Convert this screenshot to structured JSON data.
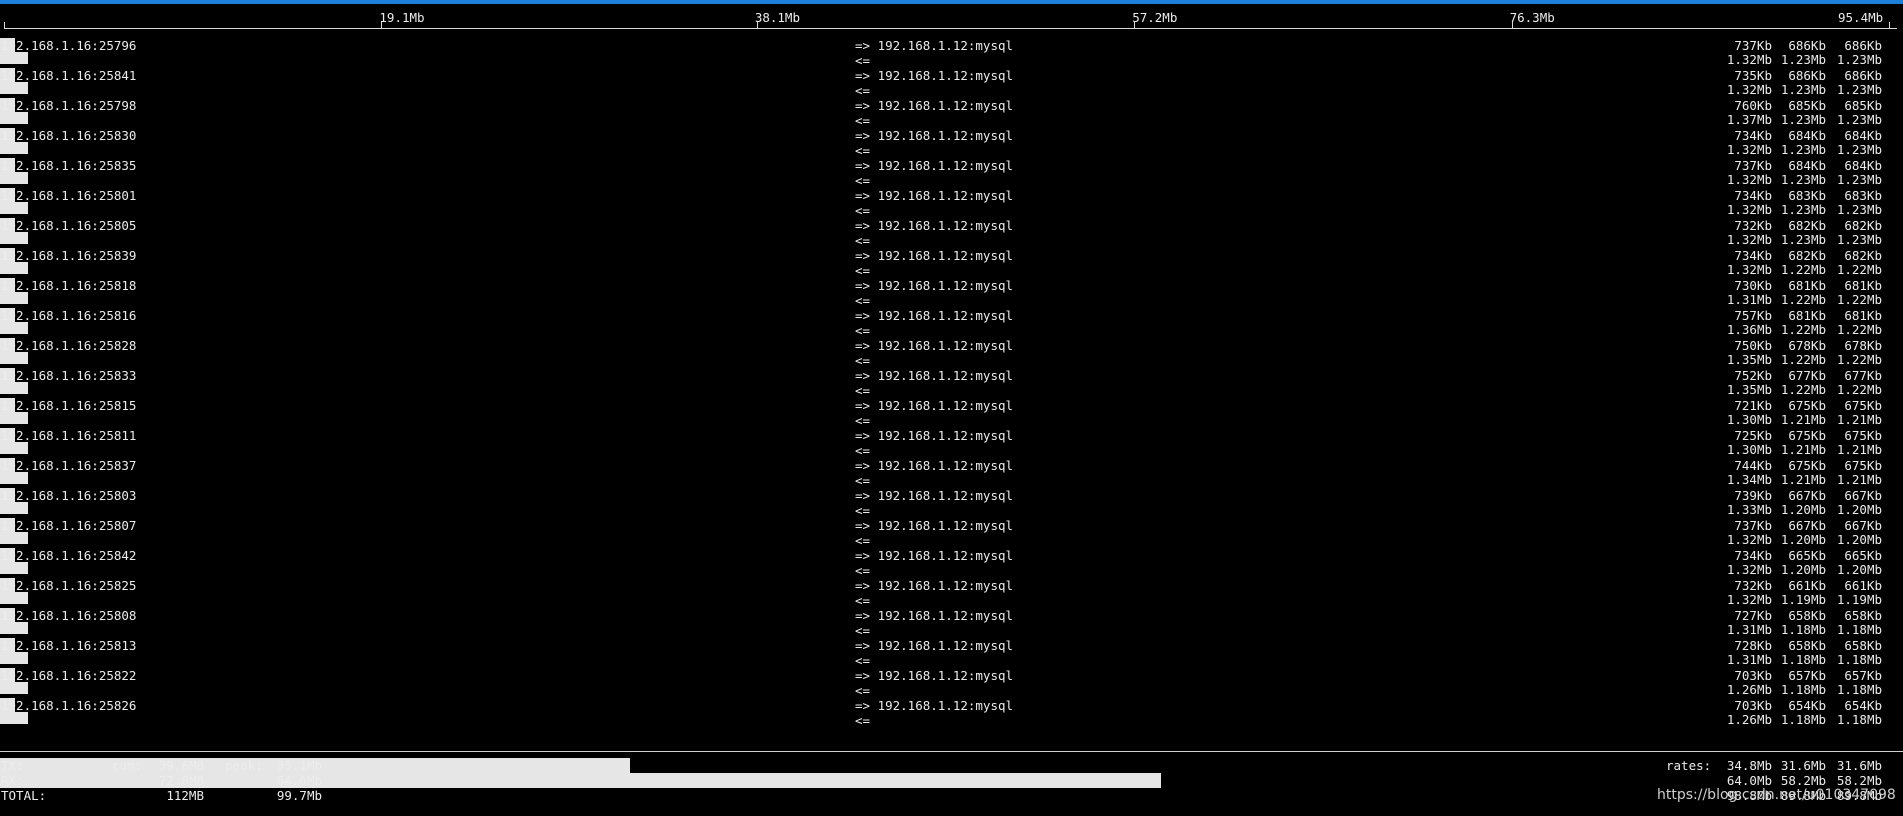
{
  "scale": {
    "labels": [
      "19.1Mb",
      "38.1Mb",
      "57.2Mb",
      "76.3Mb",
      "95.4Mb"
    ],
    "tick_values_mb": [
      19.1,
      38.1,
      57.2,
      76.3,
      95.4
    ],
    "max_mb": 95.4
  },
  "connections": [
    {
      "src": "192.168.1.16:25796",
      "out": "=> 192.168.1.12:mysql",
      "in": "<=",
      "tx": [
        "737Kb",
        "686Kb",
        "686Kb"
      ],
      "rx": [
        "1.32Mb",
        "1.23Mb",
        "1.23Mb"
      ]
    },
    {
      "src": "192.168.1.16:25841",
      "out": "=> 192.168.1.12:mysql",
      "in": "<=",
      "tx": [
        "735Kb",
        "686Kb",
        "686Kb"
      ],
      "rx": [
        "1.32Mb",
        "1.23Mb",
        "1.23Mb"
      ]
    },
    {
      "src": "192.168.1.16:25798",
      "out": "=> 192.168.1.12:mysql",
      "in": "<=",
      "tx": [
        "760Kb",
        "685Kb",
        "685Kb"
      ],
      "rx": [
        "1.37Mb",
        "1.23Mb",
        "1.23Mb"
      ]
    },
    {
      "src": "192.168.1.16:25830",
      "out": "=> 192.168.1.12:mysql",
      "in": "<=",
      "tx": [
        "734Kb",
        "684Kb",
        "684Kb"
      ],
      "rx": [
        "1.32Mb",
        "1.23Mb",
        "1.23Mb"
      ]
    },
    {
      "src": "192.168.1.16:25835",
      "out": "=> 192.168.1.12:mysql",
      "in": "<=",
      "tx": [
        "737Kb",
        "684Kb",
        "684Kb"
      ],
      "rx": [
        "1.32Mb",
        "1.23Mb",
        "1.23Mb"
      ]
    },
    {
      "src": "192.168.1.16:25801",
      "out": "=> 192.168.1.12:mysql",
      "in": "<=",
      "tx": [
        "734Kb",
        "683Kb",
        "683Kb"
      ],
      "rx": [
        "1.32Mb",
        "1.23Mb",
        "1.23Mb"
      ]
    },
    {
      "src": "192.168.1.16:25805",
      "out": "=> 192.168.1.12:mysql",
      "in": "<=",
      "tx": [
        "732Kb",
        "682Kb",
        "682Kb"
      ],
      "rx": [
        "1.32Mb",
        "1.23Mb",
        "1.23Mb"
      ]
    },
    {
      "src": "192.168.1.16:25839",
      "out": "=> 192.168.1.12:mysql",
      "in": "<=",
      "tx": [
        "734Kb",
        "682Kb",
        "682Kb"
      ],
      "rx": [
        "1.32Mb",
        "1.22Mb",
        "1.22Mb"
      ]
    },
    {
      "src": "192.168.1.16:25818",
      "out": "=> 192.168.1.12:mysql",
      "in": "<=",
      "tx": [
        "730Kb",
        "681Kb",
        "681Kb"
      ],
      "rx": [
        "1.31Mb",
        "1.22Mb",
        "1.22Mb"
      ]
    },
    {
      "src": "192.168.1.16:25816",
      "out": "=> 192.168.1.12:mysql",
      "in": "<=",
      "tx": [
        "757Kb",
        "681Kb",
        "681Kb"
      ],
      "rx": [
        "1.36Mb",
        "1.22Mb",
        "1.22Mb"
      ]
    },
    {
      "src": "192.168.1.16:25828",
      "out": "=> 192.168.1.12:mysql",
      "in": "<=",
      "tx": [
        "750Kb",
        "678Kb",
        "678Kb"
      ],
      "rx": [
        "1.35Mb",
        "1.22Mb",
        "1.22Mb"
      ]
    },
    {
      "src": "192.168.1.16:25833",
      "out": "=> 192.168.1.12:mysql",
      "in": "<=",
      "tx": [
        "752Kb",
        "677Kb",
        "677Kb"
      ],
      "rx": [
        "1.35Mb",
        "1.22Mb",
        "1.22Mb"
      ]
    },
    {
      "src": "192.168.1.16:25815",
      "out": "=> 192.168.1.12:mysql",
      "in": "<=",
      "tx": [
        "721Kb",
        "675Kb",
        "675Kb"
      ],
      "rx": [
        "1.30Mb",
        "1.21Mb",
        "1.21Mb"
      ]
    },
    {
      "src": "192.168.1.16:25811",
      "out": "=> 192.168.1.12:mysql",
      "in": "<=",
      "tx": [
        "725Kb",
        "675Kb",
        "675Kb"
      ],
      "rx": [
        "1.30Mb",
        "1.21Mb",
        "1.21Mb"
      ]
    },
    {
      "src": "192.168.1.16:25837",
      "out": "=> 192.168.1.12:mysql",
      "in": "<=",
      "tx": [
        "744Kb",
        "675Kb",
        "675Kb"
      ],
      "rx": [
        "1.34Mb",
        "1.21Mb",
        "1.21Mb"
      ]
    },
    {
      "src": "192.168.1.16:25803",
      "out": "=> 192.168.1.12:mysql",
      "in": "<=",
      "tx": [
        "739Kb",
        "667Kb",
        "667Kb"
      ],
      "rx": [
        "1.33Mb",
        "1.20Mb",
        "1.20Mb"
      ]
    },
    {
      "src": "192.168.1.16:25807",
      "out": "=> 192.168.1.12:mysql",
      "in": "<=",
      "tx": [
        "737Kb",
        "667Kb",
        "667Kb"
      ],
      "rx": [
        "1.32Mb",
        "1.20Mb",
        "1.20Mb"
      ]
    },
    {
      "src": "192.168.1.16:25842",
      "out": "=> 192.168.1.12:mysql",
      "in": "<=",
      "tx": [
        "734Kb",
        "665Kb",
        "665Kb"
      ],
      "rx": [
        "1.32Mb",
        "1.20Mb",
        "1.20Mb"
      ]
    },
    {
      "src": "192.168.1.16:25825",
      "out": "=> 192.168.1.12:mysql",
      "in": "<=",
      "tx": [
        "732Kb",
        "661Kb",
        "661Kb"
      ],
      "rx": [
        "1.32Mb",
        "1.19Mb",
        "1.19Mb"
      ]
    },
    {
      "src": "192.168.1.16:25808",
      "out": "=> 192.168.1.12:mysql",
      "in": "<=",
      "tx": [
        "727Kb",
        "658Kb",
        "658Kb"
      ],
      "rx": [
        "1.31Mb",
        "1.18Mb",
        "1.18Mb"
      ]
    },
    {
      "src": "192.168.1.16:25813",
      "out": "=> 192.168.1.12:mysql",
      "in": "<=",
      "tx": [
        "728Kb",
        "658Kb",
        "658Kb"
      ],
      "rx": [
        "1.31Mb",
        "1.18Mb",
        "1.18Mb"
      ]
    },
    {
      "src": "192.168.1.16:25822",
      "out": "=> 192.168.1.12:mysql",
      "in": "<=",
      "tx": [
        "703Kb",
        "657Kb",
        "657Kb"
      ],
      "rx": [
        "1.26Mb",
        "1.18Mb",
        "1.18Mb"
      ]
    },
    {
      "src": "192.168.1.16:25826",
      "out": "=> 192.168.1.12:mysql",
      "in": "<=",
      "tx": [
        "703Kb",
        "654Kb",
        "654Kb"
      ],
      "rx": [
        "1.26Mb",
        "1.18Mb",
        "1.18Mb"
      ]
    }
  ],
  "summary": {
    "tx": {
      "label": "TX:",
      "cum_label": "cum:",
      "cum": "39.6MB",
      "peak_label": "peak:",
      "peak": "35.1Mb",
      "rates_label": "rates:",
      "rates": [
        "34.8Mb",
        "31.6Mb",
        "31.6Mb"
      ],
      "bar_fraction": 0.331
    },
    "rx": {
      "label": "RX:",
      "cum": "72.8MB",
      "peak": "64.6Mb",
      "rates": [
        "64.0Mb",
        "58.2Mb",
        "58.2Mb"
      ],
      "bar_fraction": 0.61
    },
    "total": {
      "label": "TOTAL:",
      "cum": "112MB",
      "peak": "99.7Mb",
      "rates": [
        "98.8Mb",
        "89.8Mb",
        "89.8Mb"
      ]
    }
  },
  "watermark": "https://blog.csdn.net/u010347098"
}
